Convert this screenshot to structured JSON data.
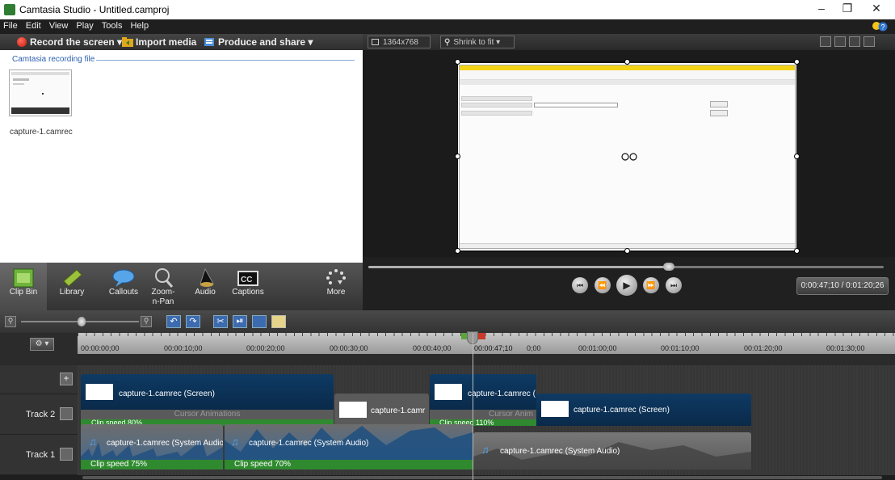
{
  "window": {
    "title": "Camtasia Studio - Untitled.camproj"
  },
  "menu": [
    "File",
    "Edit",
    "View",
    "Play",
    "Tools",
    "Help"
  ],
  "toolbar": {
    "record": "Record the screen ▾",
    "import": "Import media",
    "produce": "Produce and share ▾"
  },
  "clipbin": {
    "header": "Camtasia recording file",
    "file": "capture-1.camrec"
  },
  "tabs": [
    {
      "label": "Clip Bin",
      "icon": "film-icon"
    },
    {
      "label": "Library",
      "icon": "library-icon"
    },
    {
      "label": "Callouts",
      "icon": "callout-icon"
    },
    {
      "label": "Zoom-n-Pan",
      "icon": "zoom-icon"
    },
    {
      "label": "Audio",
      "icon": "speaker-icon"
    },
    {
      "label": "Captions",
      "icon": "cc-icon"
    },
    {
      "label": "More",
      "icon": "more-icon"
    }
  ],
  "preview": {
    "dims": "1364x768",
    "zoom": "Shrink to fit ▾",
    "timecode": "0:00:47;10 / 0:01:20;26"
  },
  "timeline": {
    "ticks": [
      "00:00:00;00",
      "00:00:10;00",
      "00:00:20;00",
      "00:00:30;00",
      "00:00:40;00",
      "00:00:47;10",
      "0;00",
      "00:01:00;00",
      "00:01:10;00",
      "00:01:20;00",
      "00:01:30;00"
    ],
    "tracks": [
      "Track 2",
      "Track 1"
    ],
    "clips": {
      "t2a": "capture-1.camrec (Screen)",
      "t2b": "capture-1.camr",
      "t2c": "capture-1.camrec (",
      "t2d": "capture-1.camrec (Screen)",
      "cursor": "Cursor Animations",
      "cursor2": "Cursor Anim",
      "speed80": "Clip speed 80%",
      "speed110": "Clip speed 110%",
      "t1a": "capture-1.camrec (System Audio",
      "t1b": "capture-1.camrec (System Audio)",
      "t1c": "capture-1.camrec (System Audio)",
      "speed75": "Clip speed 75%",
      "speed70": "Clip speed 70%"
    }
  },
  "colors": {
    "record": "#d9241a",
    "clip_blue": "#0e3a63",
    "speed_green": "#2f8a2f",
    "link": "#2a5fb2"
  }
}
